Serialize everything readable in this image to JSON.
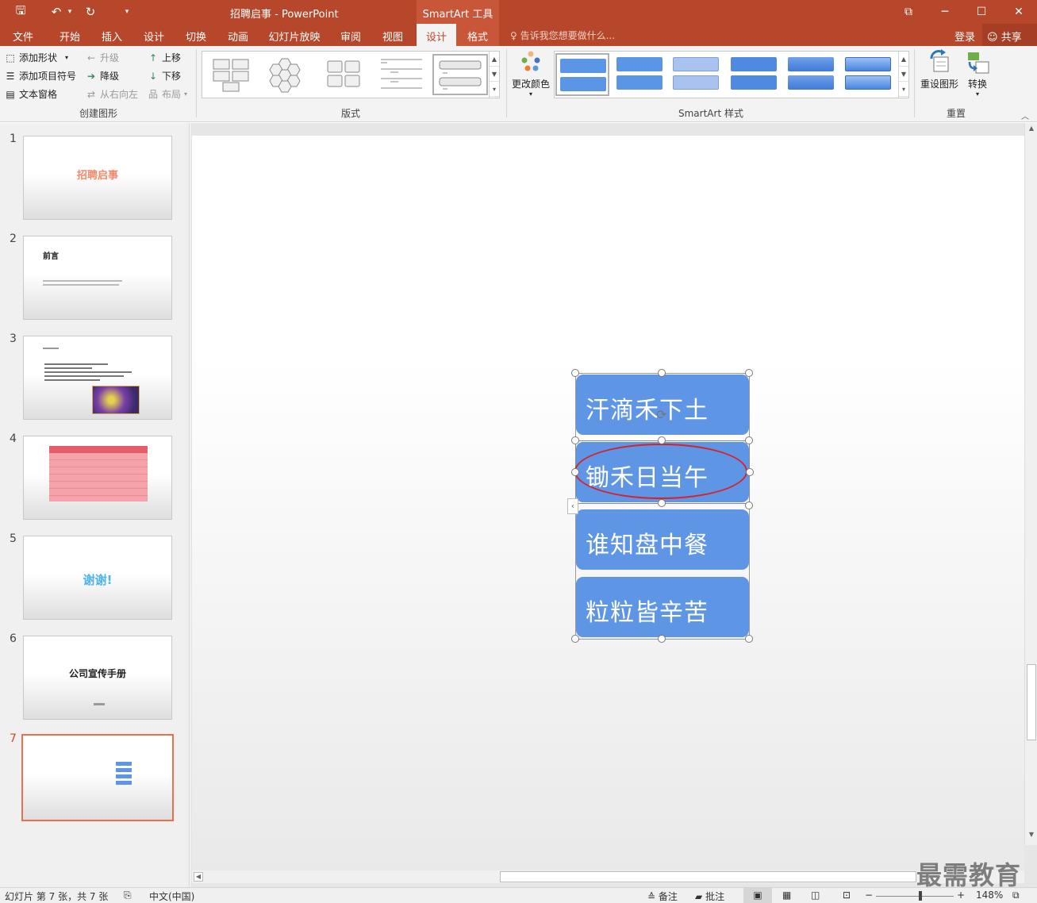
{
  "window": {
    "doc_title": "招聘启事 - PowerPoint",
    "tool_title": "SmartArt 工具",
    "restore_icon": "restore-window-icon",
    "minimize_label": "─",
    "maximize_label": "☐",
    "close_label": "✕",
    "ribbon_display_label": "⧉"
  },
  "qat": {
    "save": "🖫",
    "undo": "↶",
    "undo_dd": "▾",
    "redo": "↻",
    "customize": "▾"
  },
  "tabs": [
    "文件",
    "开始",
    "插入",
    "设计",
    "切换",
    "动画",
    "幻灯片放映",
    "审阅",
    "视图",
    "设计",
    "格式"
  ],
  "tellme": "♀ 告诉我您想要做什么...",
  "login": "登录",
  "share": "共享",
  "ribbon": {
    "create_group": {
      "label": "创建图形",
      "add_shape": "添加形状",
      "add_bullet": "添加项目符号",
      "text_pane": "文本窗格",
      "promote": "升级",
      "demote": "降级",
      "rtl": "从右向左",
      "move_up": "上移",
      "move_down": "下移",
      "layout": "布局"
    },
    "layout_group": {
      "label": "版式"
    },
    "style_group": {
      "label": "SmartArt 样式",
      "change_colors": "更改颜色"
    },
    "reset_group": {
      "label": "重置",
      "reset_graphic": "重设图形",
      "convert": "转换"
    }
  },
  "slides": [
    {
      "num": "1",
      "title": "招聘启事"
    },
    {
      "num": "2",
      "title": "前言"
    },
    {
      "num": "3",
      "title": ""
    },
    {
      "num": "4",
      "title": ""
    },
    {
      "num": "5",
      "title": "谢谢!"
    },
    {
      "num": "6",
      "title": "公司宣传手册"
    },
    {
      "num": "7",
      "title": ""
    }
  ],
  "smartart": {
    "items": [
      "汗滴禾下土",
      "锄禾日当午",
      "谁知盘中餐",
      "粒粒皆辛苦"
    ]
  },
  "status": {
    "slide_info": "幻灯片 第 7 张，共 7 张",
    "language": "中文(中国)",
    "notes": "备注",
    "comments": "批注",
    "zoom": "148%"
  },
  "watermark": "最需教育"
}
